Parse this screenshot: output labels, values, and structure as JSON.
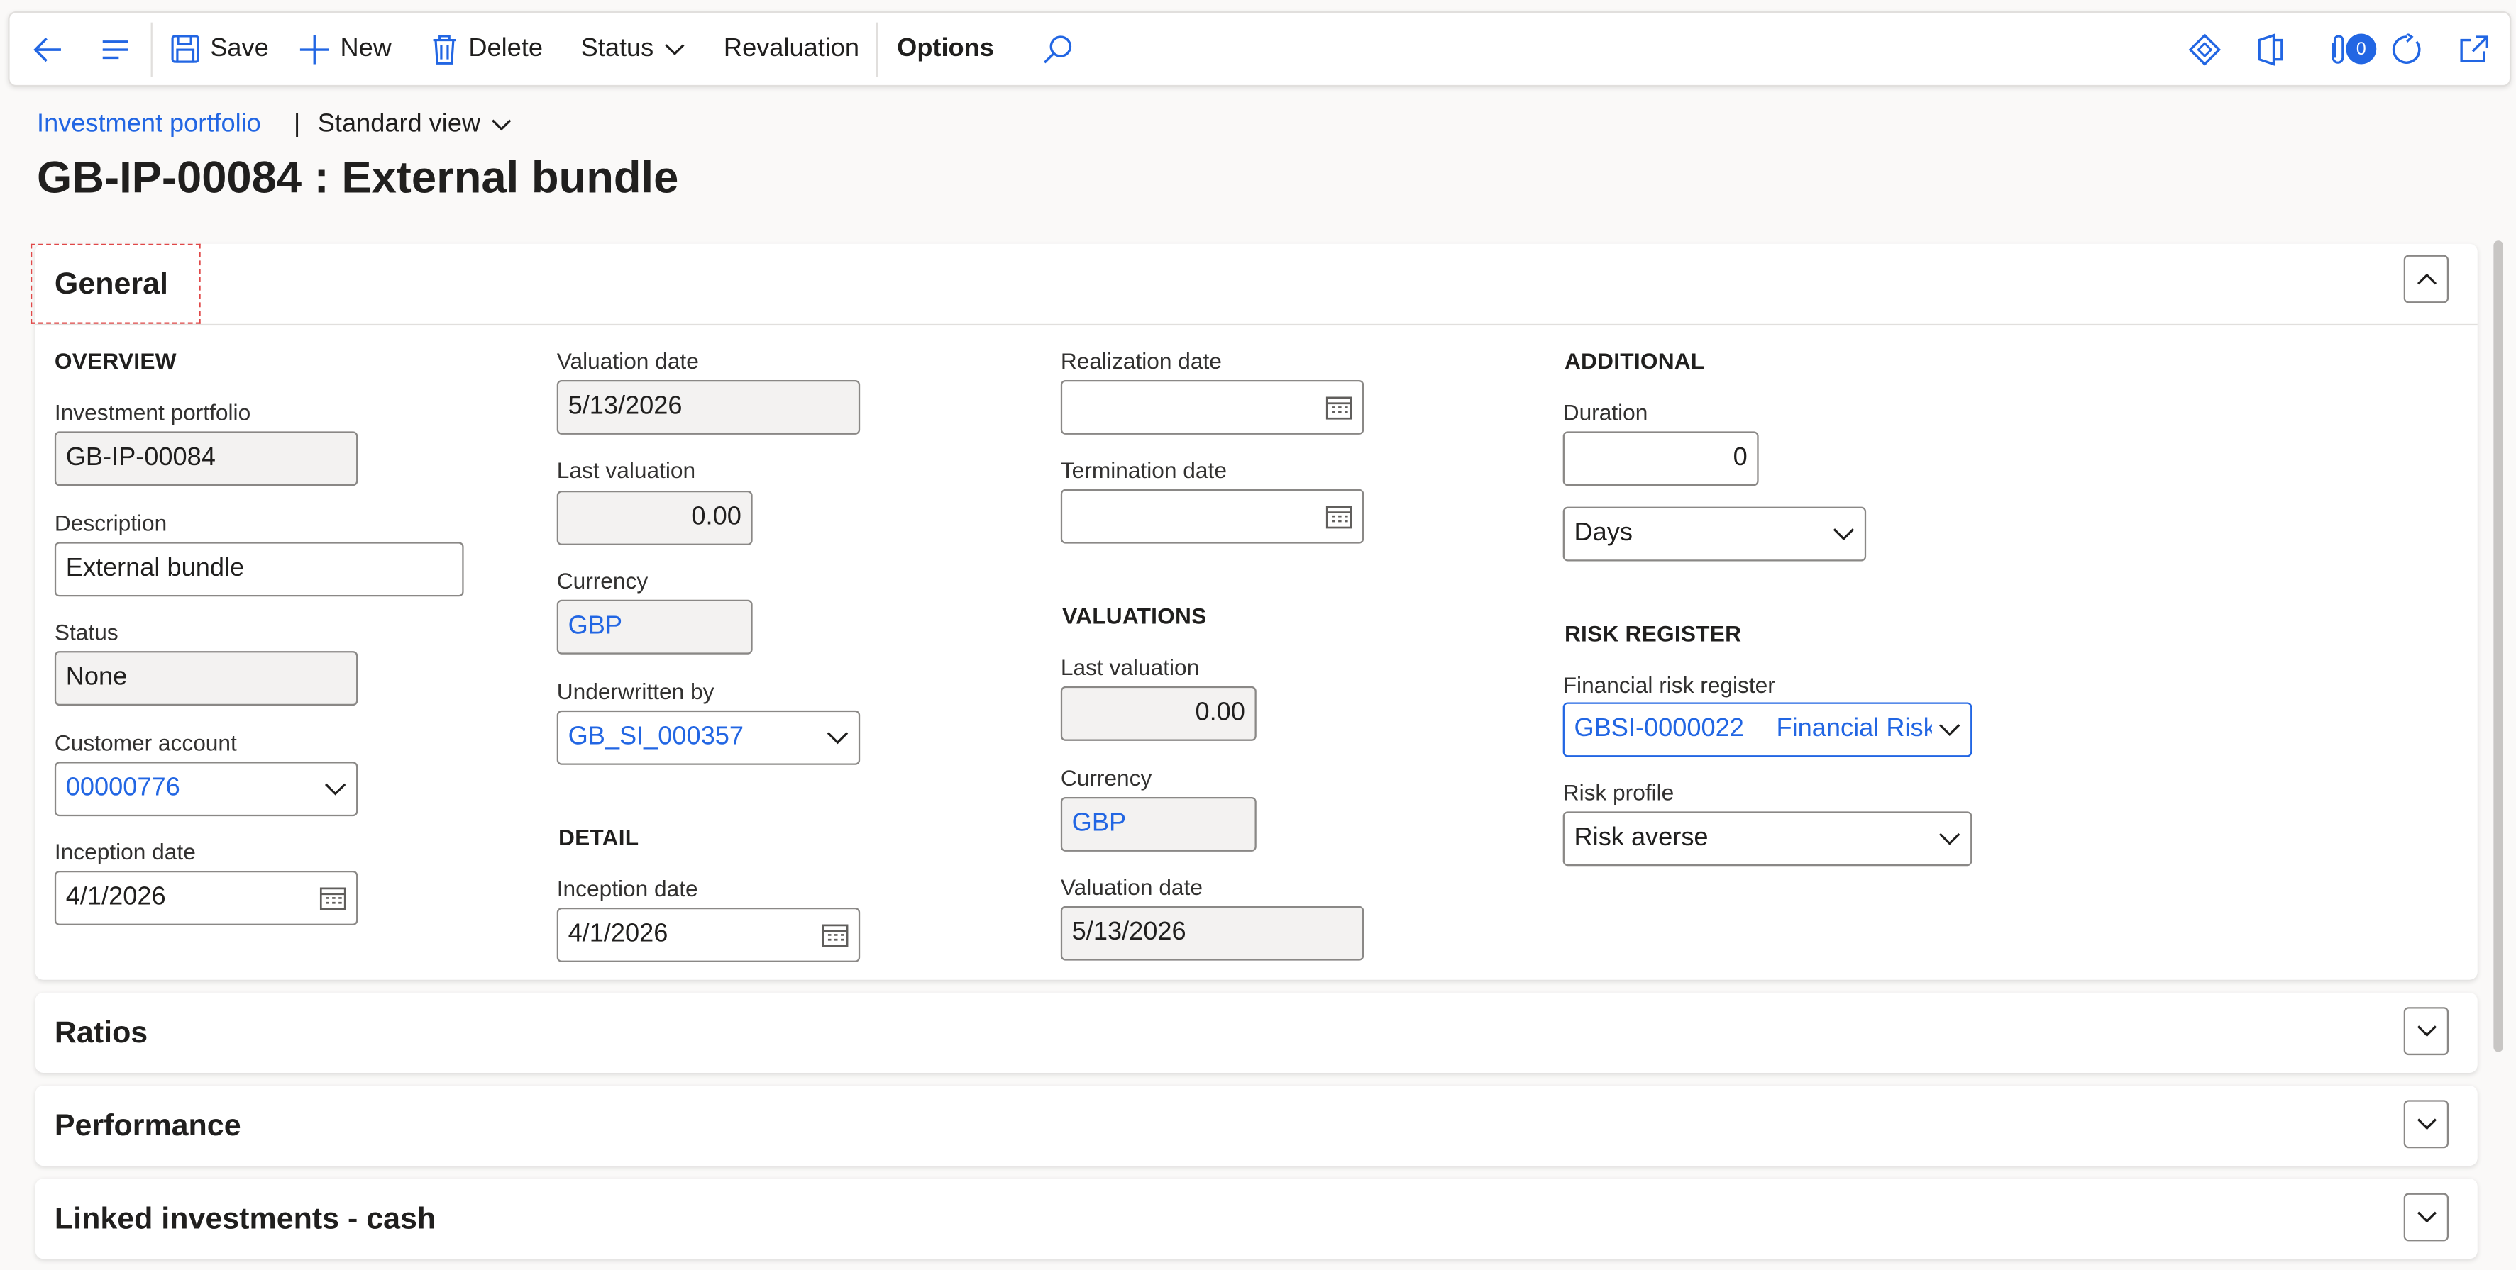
{
  "toolbar": {
    "save": "Save",
    "new": "New",
    "delete": "Delete",
    "status": "Status",
    "revaluation": "Revaluation",
    "options": "Options",
    "attachments_count": "0"
  },
  "breadcrumb": {
    "link": "Investment portfolio",
    "separator": "|",
    "view": "Standard view"
  },
  "page": {
    "title": "GB-IP-00084 : External bundle"
  },
  "general": {
    "title": "General",
    "overview": {
      "heading": "OVERVIEW",
      "investment_portfolio": {
        "label": "Investment portfolio",
        "value": "GB-IP-00084"
      },
      "description": {
        "label": "Description",
        "value": "External bundle"
      },
      "status": {
        "label": "Status",
        "value": "None"
      },
      "customer_account": {
        "label": "Customer account",
        "value": "00000776"
      },
      "inception_date": {
        "label": "Inception date",
        "value": "4/1/2026"
      }
    },
    "col2": {
      "valuation_date": {
        "label": "Valuation date",
        "value": "5/13/2026"
      },
      "last_valuation": {
        "label": "Last valuation",
        "value": "0.00"
      },
      "currency": {
        "label": "Currency",
        "value": "GBP"
      },
      "underwritten_by": {
        "label": "Underwritten by",
        "value": "GB_SI_000357"
      }
    },
    "detail": {
      "heading": "DETAIL",
      "inception_date": {
        "label": "Inception date",
        "value": "4/1/2026"
      }
    },
    "col3": {
      "realization_date": {
        "label": "Realization date",
        "value": ""
      },
      "termination_date": {
        "label": "Termination date",
        "value": ""
      }
    },
    "valuations": {
      "heading": "VALUATIONS",
      "last_valuation": {
        "label": "Last valuation",
        "value": "0.00"
      },
      "currency": {
        "label": "Currency",
        "value": "GBP"
      },
      "valuation_date": {
        "label": "Valuation date",
        "value": "5/13/2026"
      }
    },
    "additional": {
      "heading": "ADDITIONAL",
      "duration": {
        "label": "Duration",
        "value": "0"
      },
      "duration_unit": "Days"
    },
    "risk_register": {
      "heading": "RISK REGISTER",
      "financial_risk_register": {
        "label": "Financial risk register",
        "value": "GBSI-0000022",
        "description": "Financial Risk"
      },
      "risk_profile": {
        "label": "Risk profile",
        "value": "Risk averse"
      }
    }
  },
  "sections": {
    "ratios": "Ratios",
    "performance": "Performance",
    "linked_cash": "Linked investments - cash"
  },
  "colors": {
    "accent": "#2266e3",
    "text": "#201f1e",
    "readonly_bg": "#f3f2f1",
    "border": "#8a8886"
  }
}
